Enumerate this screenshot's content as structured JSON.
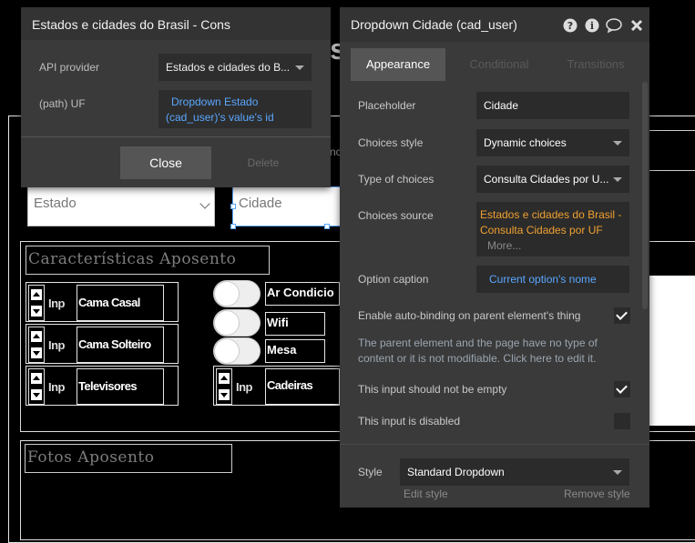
{
  "canvas": {
    "estado_placeholder": "Estado",
    "cidade_placeholder": "Cidade",
    "section_caracteristicas": "Características Aposento",
    "section_fotos": "Fotos Aposento",
    "inp_short": "Inp",
    "items": [
      "Cama Casal",
      "Cama Solteiro",
      "Televisores",
      "Cadeiras"
    ],
    "checkbox_items": [
      "Ar Condicio",
      "Wifi",
      "Mesa"
    ]
  },
  "left_popup": {
    "title": "Estados e cidades do Brasil - Cons",
    "api_provider_label": "API provider",
    "api_provider_value": "Estados e cidades do B...",
    "path_uf_label": "(path) UF",
    "path_uf_value_line1": "Dropdown Estado",
    "path_uf_value_line2": "(cad_user)'s value's id",
    "close_label": "Close",
    "delete_label": "Delete"
  },
  "inspector": {
    "title": "Dropdown Cidade (cad_user)",
    "tabs": [
      "Appearance",
      "Conditional",
      "Transitions"
    ],
    "placeholder_label": "Placeholder",
    "placeholder_value": "Cidade",
    "choices_style_label": "Choices style",
    "choices_style_value": "Dynamic choices",
    "type_of_choices_label": "Type of choices",
    "type_of_choices_value": "Consulta Cidades por U...",
    "choices_source_label": "Choices source",
    "choices_source_line1": "Estados e cidades do Brasil -",
    "choices_source_line2": "Consulta Cidades por UF",
    "choices_source_more": "More...",
    "option_caption_label": "Option caption",
    "option_caption_value": "Current option's nome",
    "auto_binding_label": "Enable auto-binding on parent element's thing",
    "auto_binding_note_line1": "The parent element and the page have no type of",
    "auto_binding_note_line2": "content or it is not modifiable. Click here to edit it.",
    "not_empty_label": "This input should not be empty",
    "disabled_label": "This input is disabled",
    "style_label": "Style",
    "style_value": "Standard Dropdown",
    "edit_style": "Edit style",
    "remove_style": "Remove style"
  },
  "colors": {
    "panel": "#3a3a3a",
    "field": "#2b2b2b",
    "link": "#5aa7ff",
    "orange": "#f0a030"
  }
}
